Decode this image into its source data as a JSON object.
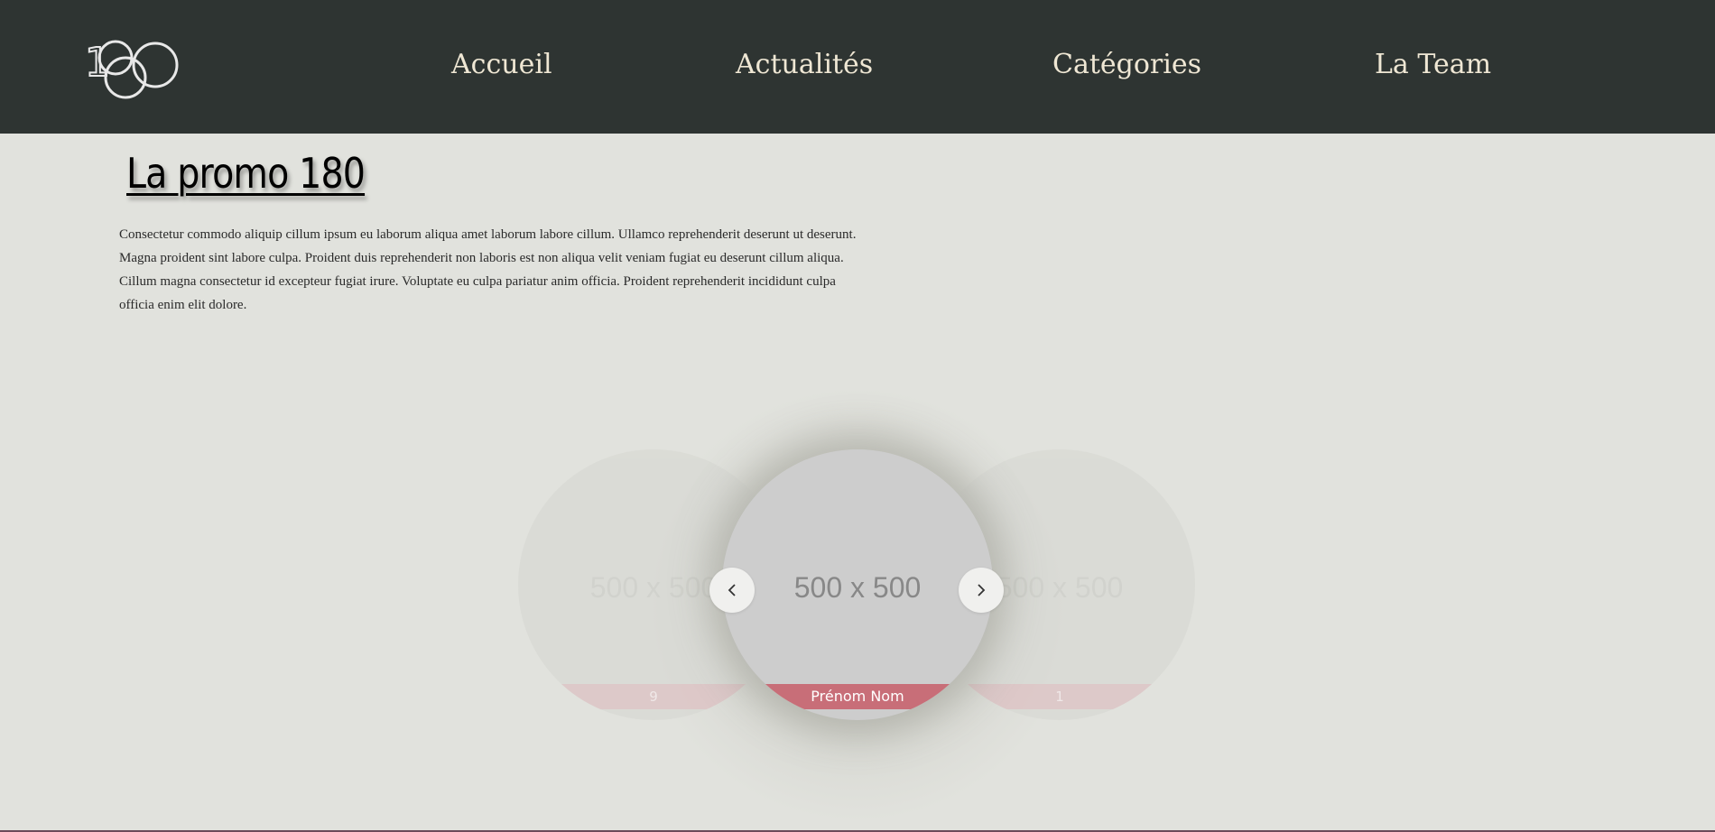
{
  "header": {
    "logo_text": "180",
    "nav": [
      {
        "label": "Accueil"
      },
      {
        "label": "Actualités"
      },
      {
        "label": "Catégories"
      },
      {
        "label": "La Team"
      }
    ]
  },
  "main": {
    "title": "La promo 180",
    "description": "Consectetur commodo aliquip cillum ipsum eu laborum aliqua amet laborum labore cillum. Ullamco reprehenderit deserunt ut deserunt. Magna proident sint labore culpa. Proident duis reprehenderit non laboris est non aliqua velit veniam fugiat eu deserunt cillum aliqua. Cillum magna consectetur id excepteur fugiat irure. Voluptate eu culpa pariatur anim officia. Proident reprehenderit incididunt culpa officia enim elit dolore."
  },
  "carousel": {
    "prev_icon": "chevron-left-icon",
    "next_icon": "chevron-right-icon",
    "cards": [
      {
        "image_text": "500 x 500",
        "name": "9"
      },
      {
        "image_text": "500 x 500",
        "name": "Prénom Nom"
      },
      {
        "image_text": "500 x 500",
        "name": "1"
      }
    ]
  },
  "colors": {
    "header_bg": "#2e3432",
    "page_bg": "#e1e2dd",
    "nav_text": "#efe7d4",
    "name_bar": "#c86e78"
  }
}
